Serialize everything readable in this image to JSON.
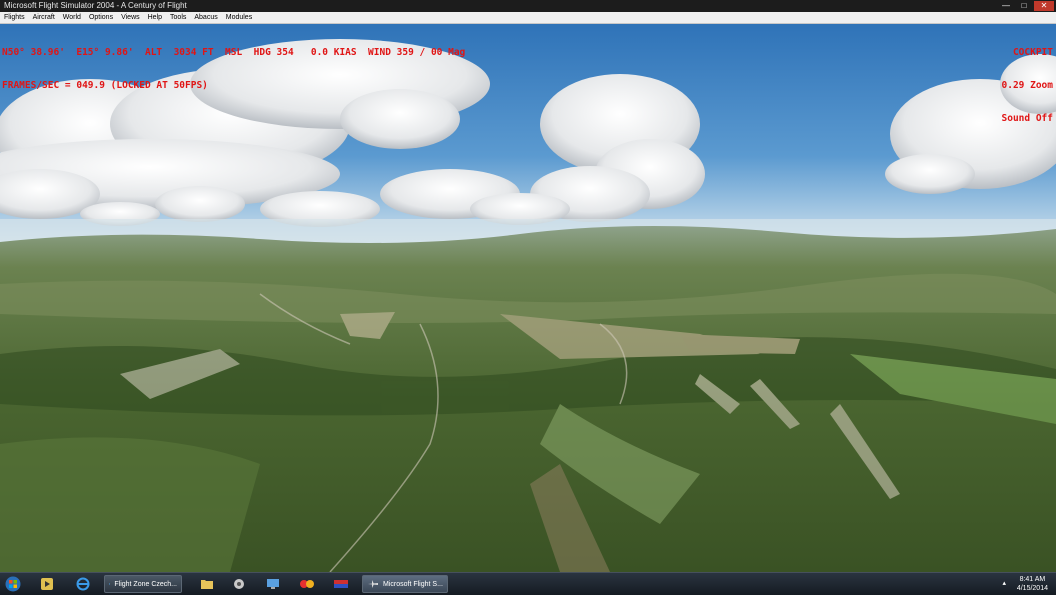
{
  "window": {
    "title": "Microsoft Flight Simulator 2004 - A Century of Flight",
    "minimize_glyph": "—",
    "maximize_glyph": "□",
    "close_glyph": "✕"
  },
  "menu": [
    "Flights",
    "Aircraft",
    "World",
    "Options",
    "Views",
    "Help",
    "Tools",
    "Abacus",
    "Modules"
  ],
  "hud": {
    "line1": "N50° 38.96'  E15° 9.86'  ALT  3034 FT  MSL  HDG 354   0.0 KIAS  WIND 359 / 00 Mag",
    "line2": "FRAMES/SEC = 049.9 (LOCKED AT 50FPS)",
    "view": "COCKPIT",
    "zoom": "0.29 Zoom",
    "sound": "Sound Off"
  },
  "taskbar": {
    "start_icon": "windows-start-icon",
    "buttons": [
      {
        "label": "Flight Zone Czech...",
        "icon": "globe-icon"
      },
      {
        "label": "Microsoft Flight S...",
        "icon": "airplane-icon"
      }
    ],
    "tray_arrow": "▴",
    "time": "8:41 AM",
    "date": "4/15/2014"
  },
  "colors": {
    "hud_text": "#e01515",
    "sky_top": "#2f73b8",
    "sky_horizon": "#cfe2ee",
    "terrain": "#3f5a2a"
  }
}
